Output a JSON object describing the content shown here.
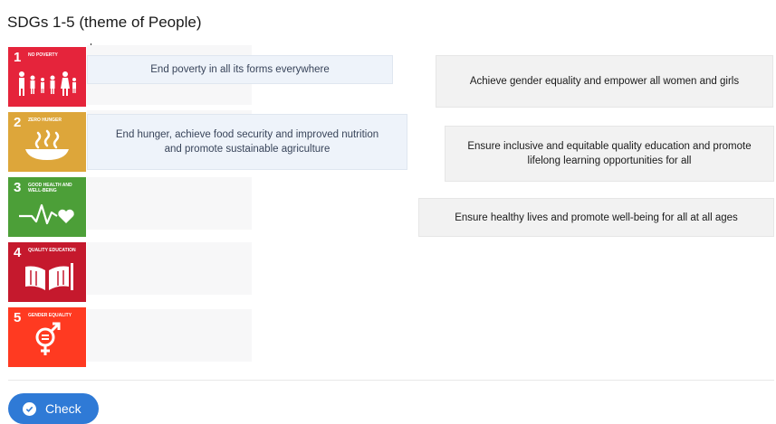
{
  "title": "SDGs 1-5 (theme of People)",
  "sdgs": [
    {
      "number": "1",
      "label": "NO POVERTY",
      "color": "#e5243b",
      "icon": "family-icon"
    },
    {
      "number": "2",
      "label": "ZERO HUNGER",
      "color": "#dda63a",
      "icon": "bowl-icon"
    },
    {
      "number": "3",
      "label": "GOOD HEALTH AND WELL-BEING",
      "color": "#4c9f38",
      "icon": "heartbeat-icon"
    },
    {
      "number": "4",
      "label": "QUALITY EDUCATION",
      "color": "#c5192d",
      "icon": "book-icon"
    },
    {
      "number": "5",
      "label": "GENDER EQUALITY",
      "color": "#ff3a21",
      "icon": "gender-equality-icon"
    }
  ],
  "placed": [
    {
      "text": "End poverty in all its forms everywhere"
    },
    {
      "text": "End hunger, achieve food security and improved nutrition and promote sustainable agriculture"
    }
  ],
  "pool": [
    {
      "text": "Achieve gender equality and empower all women and girls"
    },
    {
      "text": "Ensure inclusive and equitable quality education and promote lifelong learning opportunities for all"
    },
    {
      "text": "Ensure healthy lives and promote well-being for all at all ages"
    }
  ],
  "check_button": {
    "label": "Check",
    "icon": "check-circle-icon",
    "color": "#2f7ad6"
  }
}
